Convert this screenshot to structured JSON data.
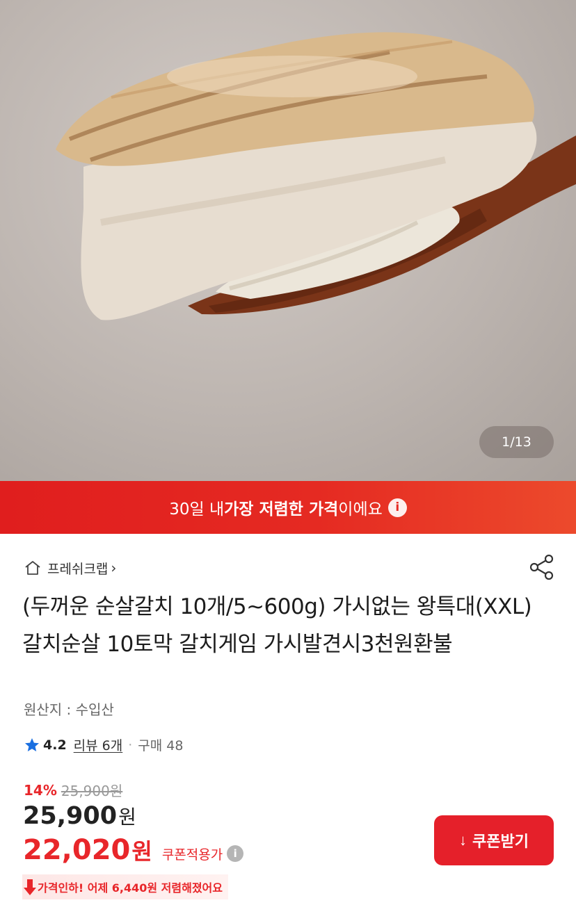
{
  "gallery": {
    "counter": "1/13"
  },
  "banner": {
    "prefix": "30일 내 ",
    "highlight": "가장 저렴한 가격",
    "suffix": "이에요",
    "info": "i"
  },
  "seller": {
    "name": "프레쉬크랩",
    "chevron": "›"
  },
  "product": {
    "title": "(두꺼운 순살갈치 10개/5~600g) 가시없는 왕특대(XXL) 갈치순살 10토막 갈치게임 가시발견시3천원환불",
    "origin": "원산지 : 수입산"
  },
  "rating": {
    "score": "4.2",
    "review": "리뷰 6개",
    "separator": "·",
    "purchases": "구매 48"
  },
  "price": {
    "discount_pct": "14%",
    "original": "25,900원",
    "sale": "25,900",
    "sale_unit": "원",
    "coupon_price": "22,020",
    "coupon_unit": "원",
    "coupon_label": "쿠폰적용가",
    "info": "i"
  },
  "price_drop": {
    "text": "가격인하! 어제 6,440원 저렴해졌어요"
  },
  "coupon_button": {
    "icon": "↓",
    "label": "쿠폰받기"
  },
  "icons": [
    "home-icon",
    "share-icon",
    "star-icon",
    "info-icon",
    "download-icon",
    "arrow-down-icon"
  ],
  "colors": {
    "accent": "#e5202a",
    "banner": "#e52a22",
    "star": "#1a6fe0"
  }
}
